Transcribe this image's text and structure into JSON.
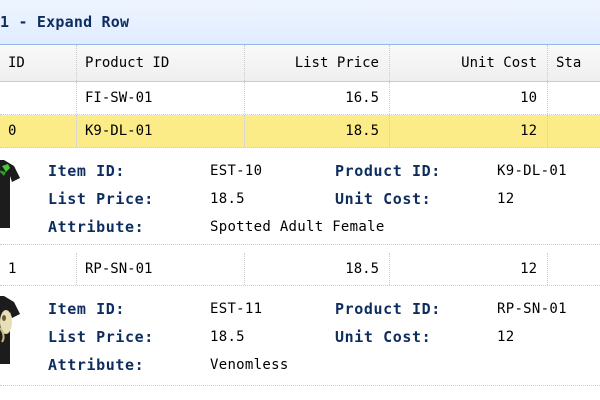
{
  "panel": {
    "title": "1 - Expand Row"
  },
  "columns": [
    "ID",
    "Product ID",
    "List Price",
    "Unit Cost",
    "Sta"
  ],
  "rows": [
    {
      "item": "",
      "product": "FI-SW-01",
      "price": "16.5",
      "cost": "10"
    },
    {
      "item": "0",
      "product": "K9-DL-01",
      "price": "18.5",
      "cost": "12"
    },
    {
      "item": "1",
      "product": "RP-SN-01",
      "price": "18.5",
      "cost": "12"
    }
  ],
  "labels": {
    "item_id": "Item ID:",
    "product_id": "Product ID:",
    "list_price": "List Price:",
    "unit_cost": "Unit Cost:",
    "attribute": "Attribute:"
  },
  "details": [
    {
      "item_id": "EST-10",
      "product_id": "K9-DL-01",
      "list_price": "18.5",
      "unit_cost": "12",
      "attribute": "Spotted Adult Female",
      "image_icon": "dog-tshirt-icon"
    },
    {
      "item_id": "EST-11",
      "product_id": "RP-SN-01",
      "list_price": "18.5",
      "unit_cost": "12",
      "attribute": "Venomless",
      "image_icon": "snake-tshirt-icon"
    }
  ],
  "colors": {
    "title_text": "#0e2d5f",
    "header_border": "#95b8e7",
    "selected_row": "#fbec88",
    "label_text": "#0e2d5f"
  }
}
